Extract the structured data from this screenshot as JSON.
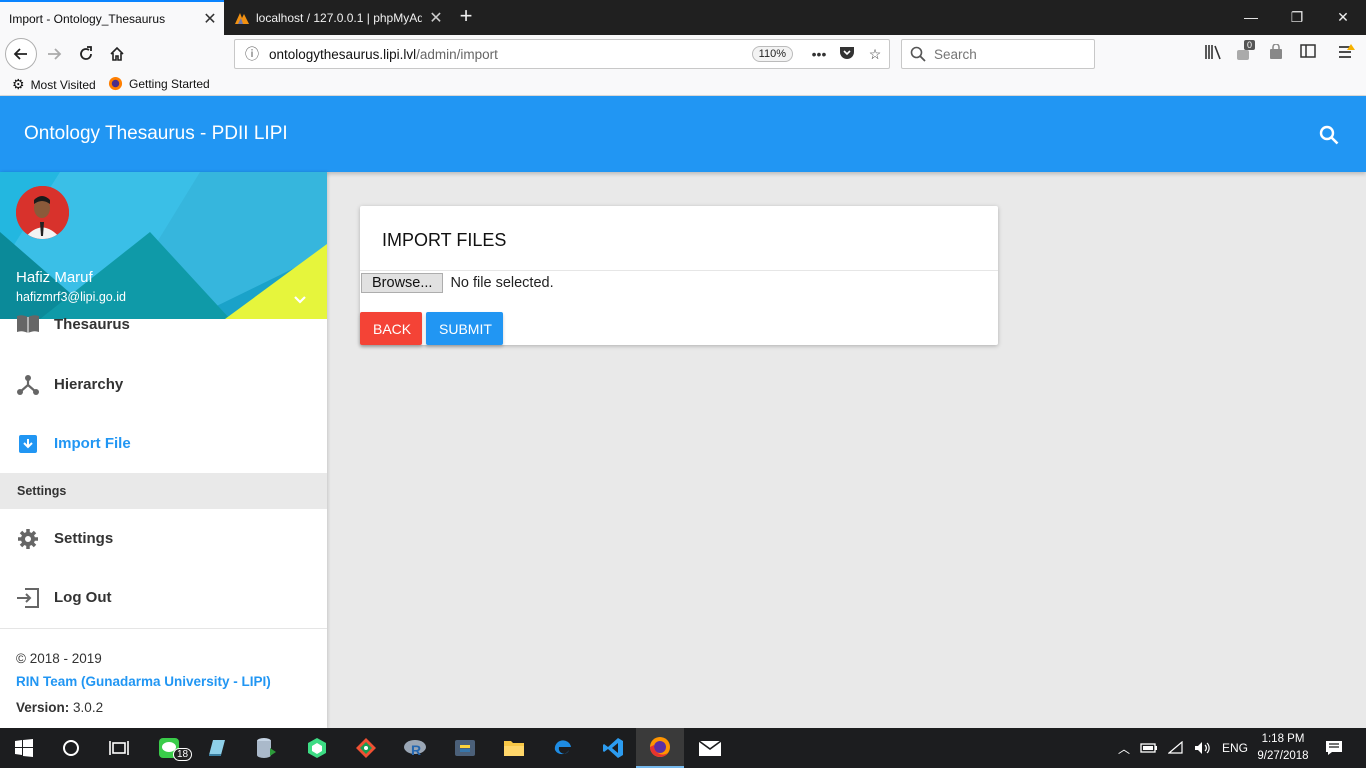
{
  "browser": {
    "tabs": [
      {
        "label": "Import - Ontology_Thesaurus",
        "active": true
      },
      {
        "label": "localhost / 127.0.0.1 | phpMyAd",
        "active": false
      }
    ],
    "url": {
      "domain": "ontologythesaurus.lipi.lvl",
      "path": "/admin/import"
    },
    "zoom": "110%",
    "search_placeholder": "Search",
    "notification_count": "0",
    "bookmarks": [
      "Most Visited",
      "Getting Started"
    ]
  },
  "app": {
    "title": "Ontology Thesaurus - PDII LIPI",
    "accent_color": "#2196f3"
  },
  "user": {
    "name": "Hafiz Maruf",
    "email": "hafizmrf3@lipi.go.id"
  },
  "sidebar": {
    "items": [
      {
        "label": "Thesaurus",
        "icon": "book-icon"
      },
      {
        "label": "Hierarchy",
        "icon": "hierarchy-icon"
      },
      {
        "label": "Import File",
        "icon": "import-icon",
        "active": true
      }
    ],
    "settings_header": "Settings",
    "settings_items": [
      {
        "label": "Settings",
        "icon": "gear-icon"
      },
      {
        "label": "Log Out",
        "icon": "logout-icon"
      }
    ],
    "footer": {
      "copyright": "© 2018 - 2019",
      "team": "RIN Team (Gunadarma University - LIPI)",
      "version_label": "Version:",
      "version": "3.0.2"
    }
  },
  "import_card": {
    "title": "IMPORT FILES",
    "browse_label": "Browse...",
    "file_status": "No file selected.",
    "back_label": "BACK",
    "submit_label": "SUBMIT",
    "back_color": "#f44336"
  },
  "taskbar": {
    "line_badge": "18",
    "language": "ENG",
    "time": "1:18 PM",
    "date": "9/27/2018"
  }
}
